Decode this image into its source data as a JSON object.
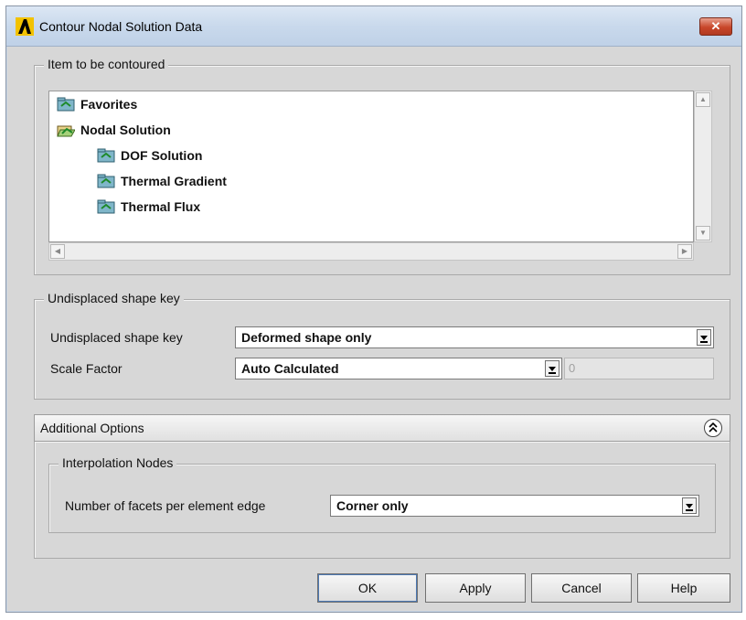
{
  "window": {
    "title": "Contour Nodal Solution Data",
    "close_label": "✕"
  },
  "item_group": {
    "label": "Item to be contoured",
    "tree": [
      {
        "label": "Favorites",
        "level": 0,
        "icon": "folder-closed-icon"
      },
      {
        "label": "Nodal Solution",
        "level": 0,
        "icon": "folder-open-icon"
      },
      {
        "label": "DOF Solution",
        "level": 1,
        "icon": "folder-closed-icon"
      },
      {
        "label": "Thermal Gradient",
        "level": 1,
        "icon": "folder-closed-icon"
      },
      {
        "label": "Thermal Flux",
        "level": 1,
        "icon": "folder-closed-icon"
      }
    ]
  },
  "undisplaced_group": {
    "label": "Undisplaced shape key",
    "shape_key_label": "Undisplaced shape key",
    "shape_key_value": "Deformed shape only",
    "scale_factor_label": "Scale Factor",
    "scale_factor_value": "Auto Calculated",
    "scale_factor_number": "0"
  },
  "additional_options": {
    "label": "Additional Options",
    "interpolation_group_label": "Interpolation Nodes",
    "facets_label": "Number of facets per element edge",
    "facets_value": "Corner only"
  },
  "buttons": {
    "ok": "OK",
    "apply": "Apply",
    "cancel": "Cancel",
    "help": "Help"
  },
  "colors": {
    "dialog_bg": "#d7d7d7",
    "titlebar": "#c9d9ec",
    "close_button": "#c8462a"
  }
}
